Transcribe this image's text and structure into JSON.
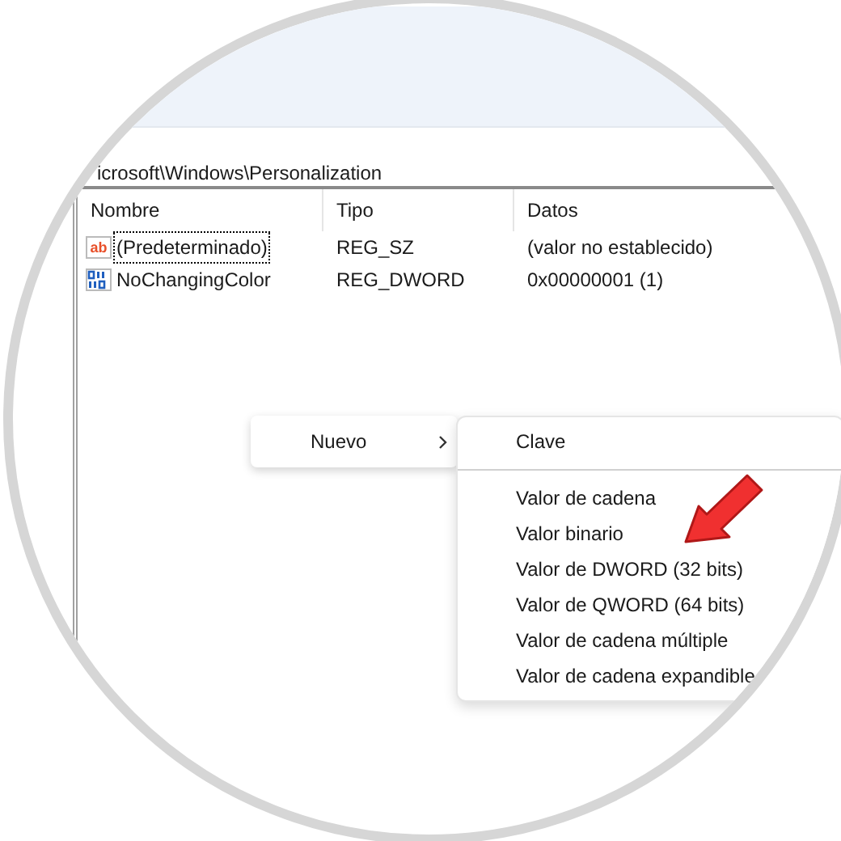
{
  "address_bar": {
    "path": "icrosoft\\Windows\\Personalization"
  },
  "table": {
    "columns": [
      "Nombre",
      "Tipo",
      "Datos"
    ],
    "rows": [
      {
        "kind": "string",
        "icon_label": "ab",
        "name": "(Predeterminado)",
        "type": "REG_SZ",
        "data": "(valor no establecido)",
        "focused": true
      },
      {
        "kind": "dword",
        "name": "NoChangingColor",
        "type": "REG_DWORD",
        "data": "0x00000001 (1)",
        "focused": false
      }
    ]
  },
  "context_menu": {
    "items": [
      {
        "label": "Nuevo",
        "has_submenu": true
      }
    ]
  },
  "submenu": {
    "sections": [
      [
        "Clave"
      ],
      [
        "Valor de cadena",
        "Valor binario",
        "Valor de DWORD (32 bits)",
        "Valor de QWORD (64 bits)",
        "Valor de cadena múltiple",
        "Valor de cadena expandible"
      ]
    ]
  }
}
